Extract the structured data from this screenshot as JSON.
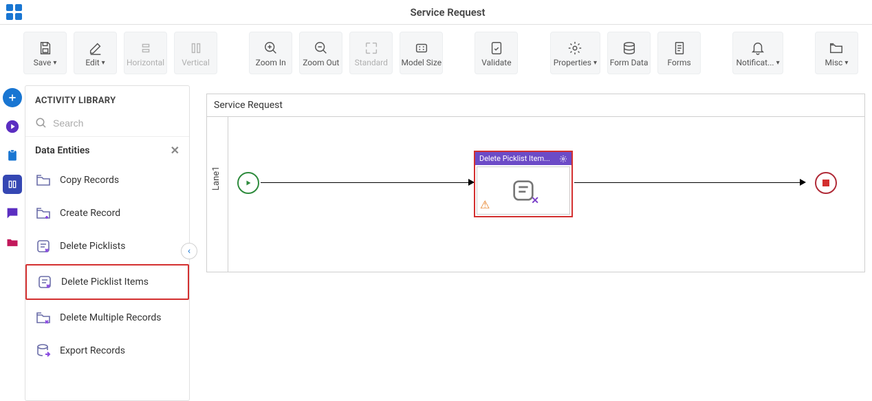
{
  "header": {
    "title": "Service Request"
  },
  "toolbar": {
    "save": "Save",
    "edit": "Edit",
    "horizontal": "Horizontal",
    "vertical": "Vertical",
    "zoom_in": "Zoom In",
    "zoom_out": "Zoom Out",
    "standard": "Standard",
    "model_size": "Model Size",
    "validate": "Validate",
    "properties": "Properties",
    "form_data": "Form Data",
    "forms": "Forms",
    "notifications": "Notificat...",
    "misc": "Misc"
  },
  "sidebar": {
    "title": "ACTIVITY LIBRARY",
    "search_placeholder": "Search",
    "category": "Data Entities",
    "items": [
      {
        "label": "Copy Records"
      },
      {
        "label": "Create Record"
      },
      {
        "label": "Delete Picklists"
      },
      {
        "label": "Delete Picklist Items"
      },
      {
        "label": "Delete Multiple Records"
      },
      {
        "label": "Export Records"
      }
    ]
  },
  "canvas": {
    "title": "Service Request",
    "lane": "Lane1",
    "activity_label": "Delete Picklist Item..."
  }
}
